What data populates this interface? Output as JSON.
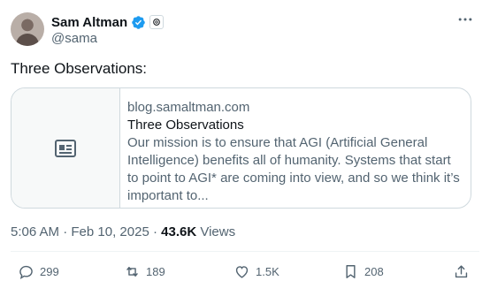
{
  "author": {
    "name": "Sam Altman",
    "handle": "@sama",
    "verified_icon": "verified-badge-icon",
    "affiliation_icon": "openai-logo-icon"
  },
  "menu_icon": "more-icon",
  "tweet": {
    "text": "Three Observations:"
  },
  "card": {
    "thumb_icon": "article-icon",
    "domain": "blog.samaltman.com",
    "title": "Three Observations",
    "description": "Our mission is to ensure that AGI (Artificial General Intelligence) benefits all of humanity.  Systems that start to point to AGI* are coming into view, and so we think it’s important to..."
  },
  "meta": {
    "time": "5:06 AM",
    "separator": "·",
    "date": "Feb 10, 2025",
    "separator2": "·",
    "views_count": "43.6K",
    "views_label": "Views"
  },
  "actions": {
    "replies": "299",
    "reposts": "189",
    "likes": "1.5K",
    "bookmarks": "208"
  },
  "colors": {
    "text": "#0f1419",
    "secondary": "#536471",
    "border": "#cfd9de",
    "verified": "#1d9bf0"
  }
}
